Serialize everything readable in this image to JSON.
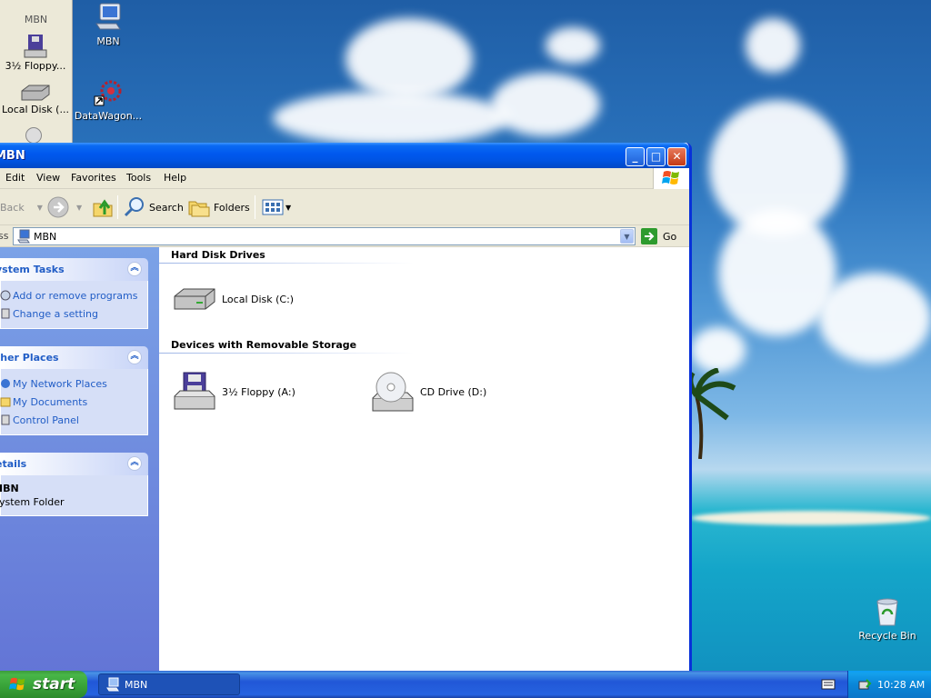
{
  "desktop": {
    "icons": [
      {
        "label": "MBN"
      },
      {
        "label": "DataWagon..."
      },
      {
        "label": "Recycle Bin"
      }
    ],
    "bg_window": {
      "title": "MBN",
      "items": [
        {
          "label": "3½ Floppy..."
        },
        {
          "label": "Local Disk (..."
        }
      ]
    }
  },
  "window": {
    "title": "MBN",
    "menu": [
      "Edit",
      "View",
      "Favorites",
      "Tools",
      "Help"
    ],
    "toolbar": {
      "back": "Back",
      "search": "Search",
      "folders": "Folders"
    },
    "address": {
      "label": "ss",
      "value": "MBN",
      "go": "Go"
    },
    "tasks": {
      "system_tasks": {
        "title": "ystem Tasks",
        "items": [
          {
            "label": "Add or remove programs"
          },
          {
            "label": "Change a setting"
          }
        ]
      },
      "other_places": {
        "title": "ther Places",
        "items": [
          {
            "label": "My Network Places"
          },
          {
            "label": "My Documents"
          },
          {
            "label": "Control Panel"
          }
        ]
      },
      "details": {
        "title": "etails",
        "name": "IBN",
        "type": "ystem Folder"
      }
    },
    "content": {
      "groups": [
        {
          "title": "Hard Disk Drives",
          "drives": [
            {
              "label": "Local Disk (C:)"
            }
          ]
        },
        {
          "title": "Devices with Removable Storage",
          "drives": [
            {
              "label": "3½ Floppy (A:)"
            },
            {
              "label": "CD Drive (D:)"
            }
          ]
        }
      ]
    }
  },
  "taskbar": {
    "start": "start",
    "tasks": [
      {
        "label": "MBN"
      }
    ],
    "clock": "10:28 AM"
  },
  "colors": {
    "title_blue": "#0054e3",
    "task_link": "#215dc6",
    "start_green": "#37a137"
  }
}
